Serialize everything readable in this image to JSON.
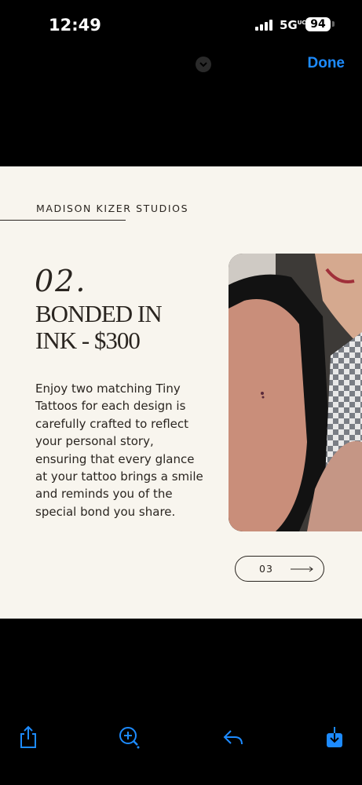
{
  "status_bar": {
    "time": "12:49",
    "network": "5G",
    "network_suffix": "UC",
    "battery": "94"
  },
  "top_nav": {
    "done_label": "Done"
  },
  "document": {
    "brand": "MADISON KIZER STUDIOS",
    "number": "02.",
    "title_line1": "BONDED IN",
    "title_line2": "INK - $300",
    "body": "Enjoy two matching Tiny Tattoos for each design is carefully crafted to reflect your personal story, ensuring that every glance at your tattoo brings a smile and reminds you of the special bond you share.",
    "pager_label": "03"
  },
  "toolbar": {
    "icons": [
      "share-icon",
      "markup-icon",
      "reply-icon",
      "save-icon"
    ]
  },
  "colors": {
    "accent": "#1d8bff",
    "page_bg": "#f8f5ee",
    "ink": "#2a2520"
  }
}
